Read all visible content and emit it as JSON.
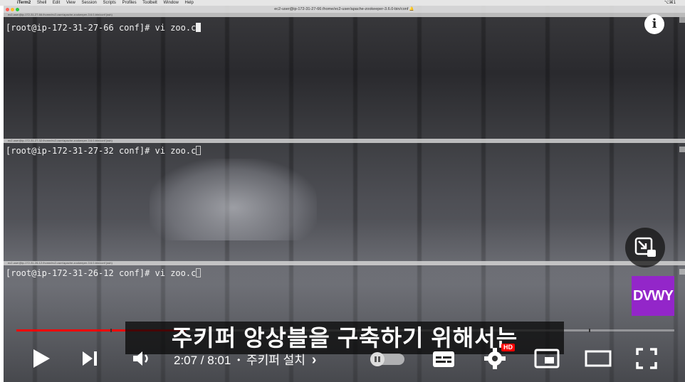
{
  "menubar": {
    "apple": "",
    "items": [
      "iTerm2",
      "Shell",
      "Edit",
      "View",
      "Session",
      "Scripts",
      "Profiles",
      "Toolbelt",
      "Window",
      "Help"
    ],
    "right": "⌥⌘1"
  },
  "window": {
    "title": "ec2-user@ip-172-31-27-66:/home/ec2-user/apache-zookeeper-3.6.0-bin/conf 🔔"
  },
  "panes": [
    {
      "tab": "ec2-user@ip-172-31-27-66:/home/ec2-user/apache-zookeeper-3.6.0-bin/conf (ssh)",
      "prompt": "[root@ip-172-31-27-66 conf]# vi zoo.c"
    },
    {
      "tab": "ec2-user@ip-172-31-27-32:/home/ec2-user/apache-zookeeper-3.6.0-bin/conf (ssh)",
      "prompt": "[root@ip-172-31-27-32 conf]# vi zoo.c"
    },
    {
      "tab": "ec2-user@ip-172-31-26-12:/home/ec2-user/apache-zookeeper-3.6.0-bin/conf (ssh)",
      "prompt": "[root@ip-172-31-26-12 conf]# vi zoo.c"
    }
  ],
  "overlay": {
    "info_label": "i",
    "channel_badge": "DVWY",
    "subtitle": "주키퍼 앙상블을 구축하기 위해서는"
  },
  "player": {
    "progress_fraction": 0.258,
    "time": "2:07 / 8:01",
    "separator": "•",
    "chapter": "주키퍼 설치",
    "chapter_arrow": "›",
    "hd_badge": "HD",
    "colors": {
      "played": "#ff0000",
      "badge": "#9326c9"
    }
  }
}
